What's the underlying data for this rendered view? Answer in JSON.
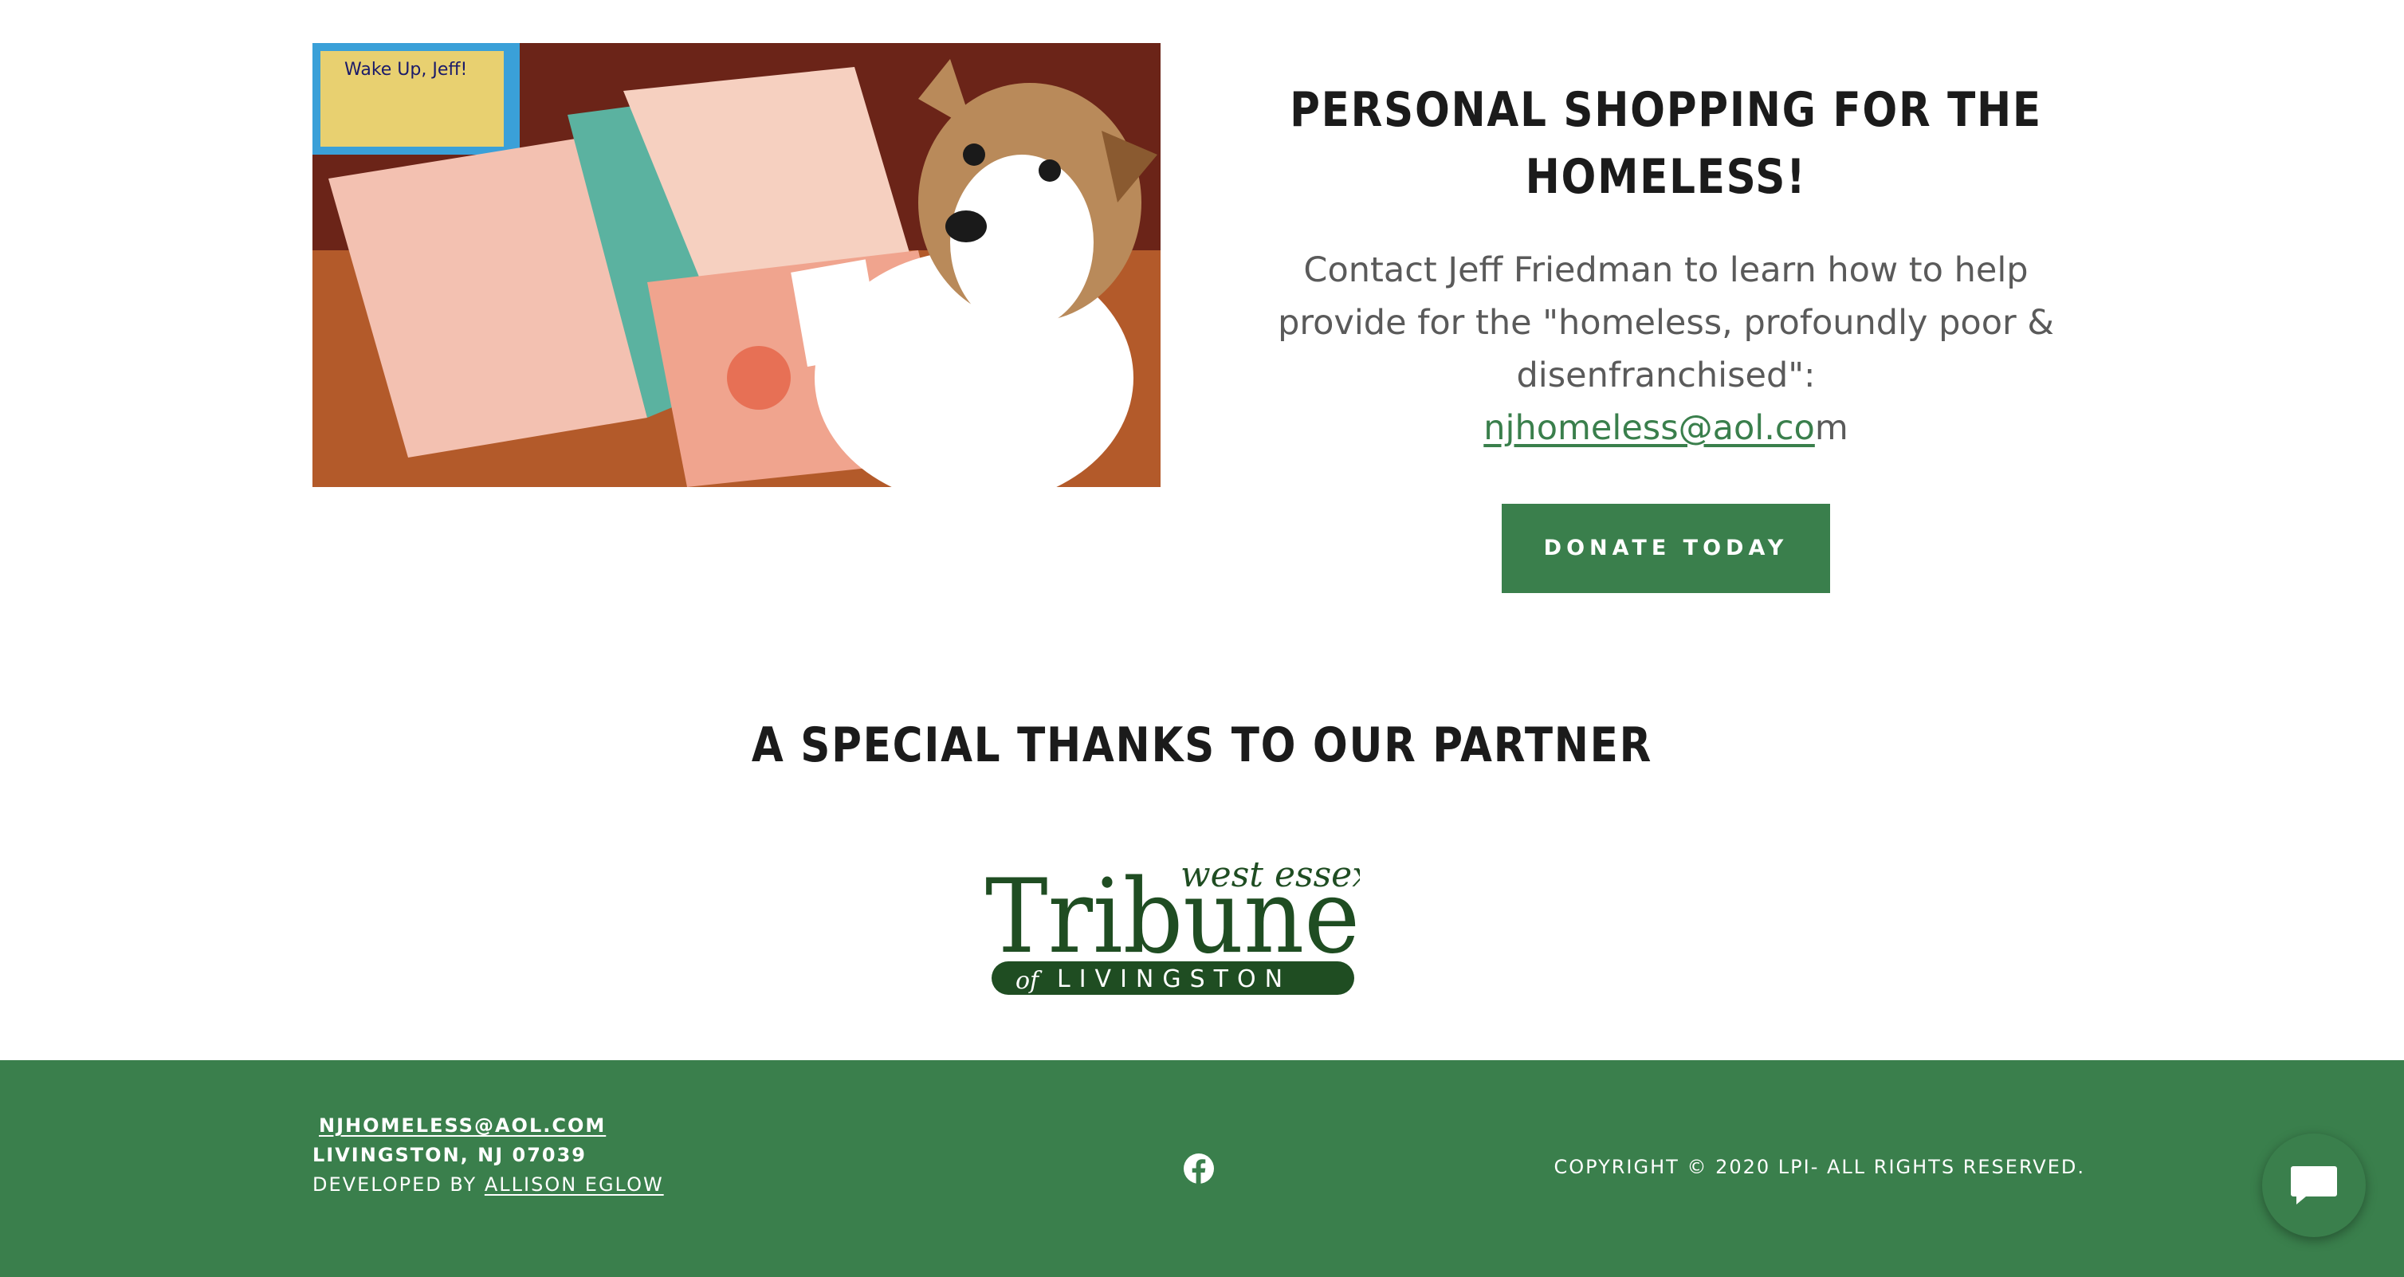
{
  "promo": {
    "title": "PERSONAL SHOPPING FOR THE HOMELESS!",
    "text_before": "Contact Jeff Friedman to learn how to help provide for the \"homeless, profoundly poor & disenfranchised\":",
    "email_link": "njhomeless@aol.co",
    "email_suffix": "m",
    "donate_label": "DONATE TODAY"
  },
  "photo": {
    "book_text": "Wake Up, Jeff!"
  },
  "partner": {
    "title": "A SPECIAL THANKS TO OUR PARTNER",
    "logo_text": {
      "script": "west essex",
      "main": "Tribune",
      "of": "of",
      "town": "LIVINGSTON"
    }
  },
  "footer": {
    "email": "NJHOMELESS@AOL.COM",
    "address": "LIVINGSTON, NJ 07039",
    "developed_by": "DEVELOPED BY",
    "developer": "ALLISON EGLOW",
    "copyright": "COPYRIGHT © 2020 LPI- ALL RIGHTS RESERVED."
  },
  "colors": {
    "brand_green": "#3a7f4c",
    "logo_green": "#1f4d22"
  },
  "icons": {
    "social": "facebook-icon",
    "chat": "chat-bubble-icon"
  }
}
